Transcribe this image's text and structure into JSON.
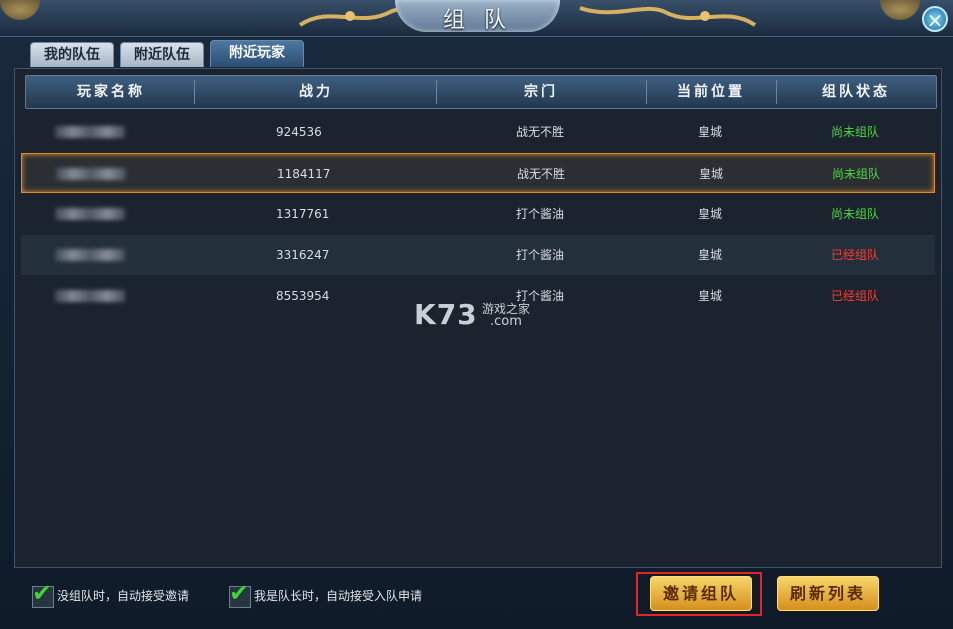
{
  "window": {
    "title": "组 队",
    "close_icon": "close-icon"
  },
  "tabs": [
    {
      "label": "我的队伍",
      "active": false
    },
    {
      "label": "附近队伍",
      "active": false
    },
    {
      "label": "附近玩家",
      "active": true
    }
  ],
  "table": {
    "columns": [
      "玩家名称",
      "战力",
      "宗门",
      "当前位置",
      "组队状态"
    ],
    "rows": [
      {
        "power": "924536",
        "sect": "战无不胜",
        "location": "皇城",
        "status": "尚未组队"
      },
      {
        "power": "1184117",
        "sect": "战无不胜",
        "location": "皇城",
        "status": "尚未组队"
      },
      {
        "power": "1317761",
        "sect": "打个酱油",
        "location": "皇城",
        "status": "尚未组队"
      },
      {
        "power": "3316247",
        "sect": "打个酱油",
        "location": "皇城",
        "status": "已经组队"
      },
      {
        "power": "8553954",
        "sect": "打个酱油",
        "location": "皇城",
        "status": "已经组队"
      }
    ]
  },
  "watermark": {
    "logo": "K73",
    "text": "游戏之家",
    "domain": ".com"
  },
  "footer": {
    "auto_accept_invite_label": "没组队时，自动接受邀请",
    "auto_accept_apply_label": "我是队长时，自动接受入队申请",
    "invite_button": "邀请组队",
    "refresh_button": "刷新列表"
  },
  "colors": {
    "status_green": "#4cd83e",
    "status_red": "#ff3a2d",
    "selected_border": "#e18a2c",
    "highlight": "#e42525"
  }
}
